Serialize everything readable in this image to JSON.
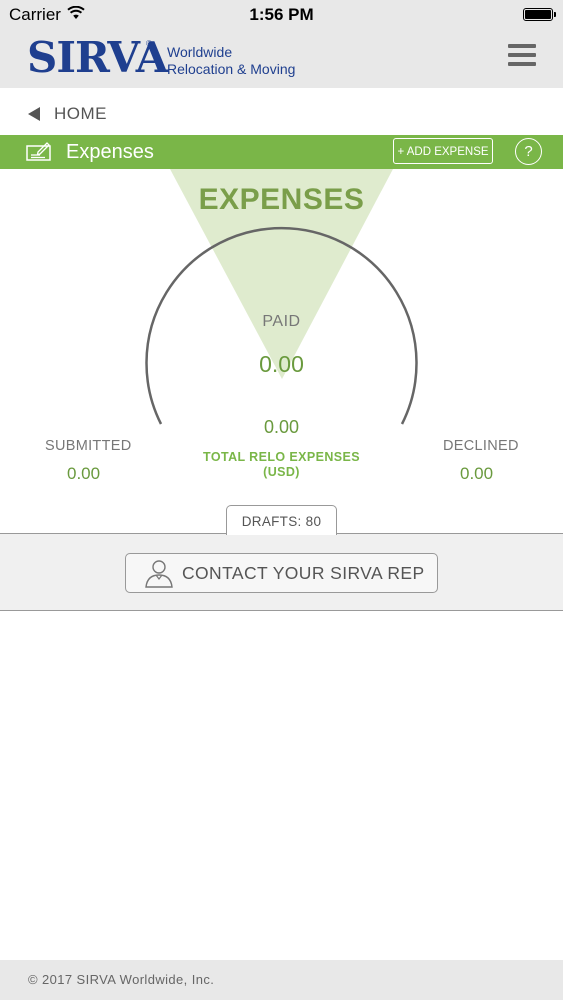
{
  "status_bar": {
    "carrier": "Carrier",
    "time": "1:56 PM"
  },
  "header": {
    "logo_text": "SIRVA",
    "logo_mark": "®",
    "tagline_line1": "Worldwide",
    "tagline_line2": "Relocation & Moving",
    "menu_icon": "hamburger-menu-icon"
  },
  "breadcrumb": {
    "home_label": "HOME"
  },
  "section": {
    "title": "Expenses",
    "add_expense_label": "+ ADD EXPENSE",
    "help_label": "?"
  },
  "gauge": {
    "title": "EXPENSES",
    "paid_label": "PAID",
    "paid_value": "0.00",
    "total_value": "0.00",
    "total_label_line1": "TOTAL RELO EXPENSES",
    "total_label_line2": "(USD)",
    "submitted_label": "SUBMITTED",
    "submitted_value": "0.00",
    "declined_label": "DECLINED",
    "declined_value": "0.00",
    "drafts_label": "DRAFTS: 80"
  },
  "contact": {
    "label": "CONTACT YOUR SIRVA REP",
    "icon": "person-icon"
  },
  "footer": {
    "copyright": "© 2017 SIRVA Worldwide, Inc."
  },
  "colors": {
    "brand_blue": "#1f3f8f",
    "accent_green": "#7ab648",
    "value_green": "#6a9a3e"
  }
}
